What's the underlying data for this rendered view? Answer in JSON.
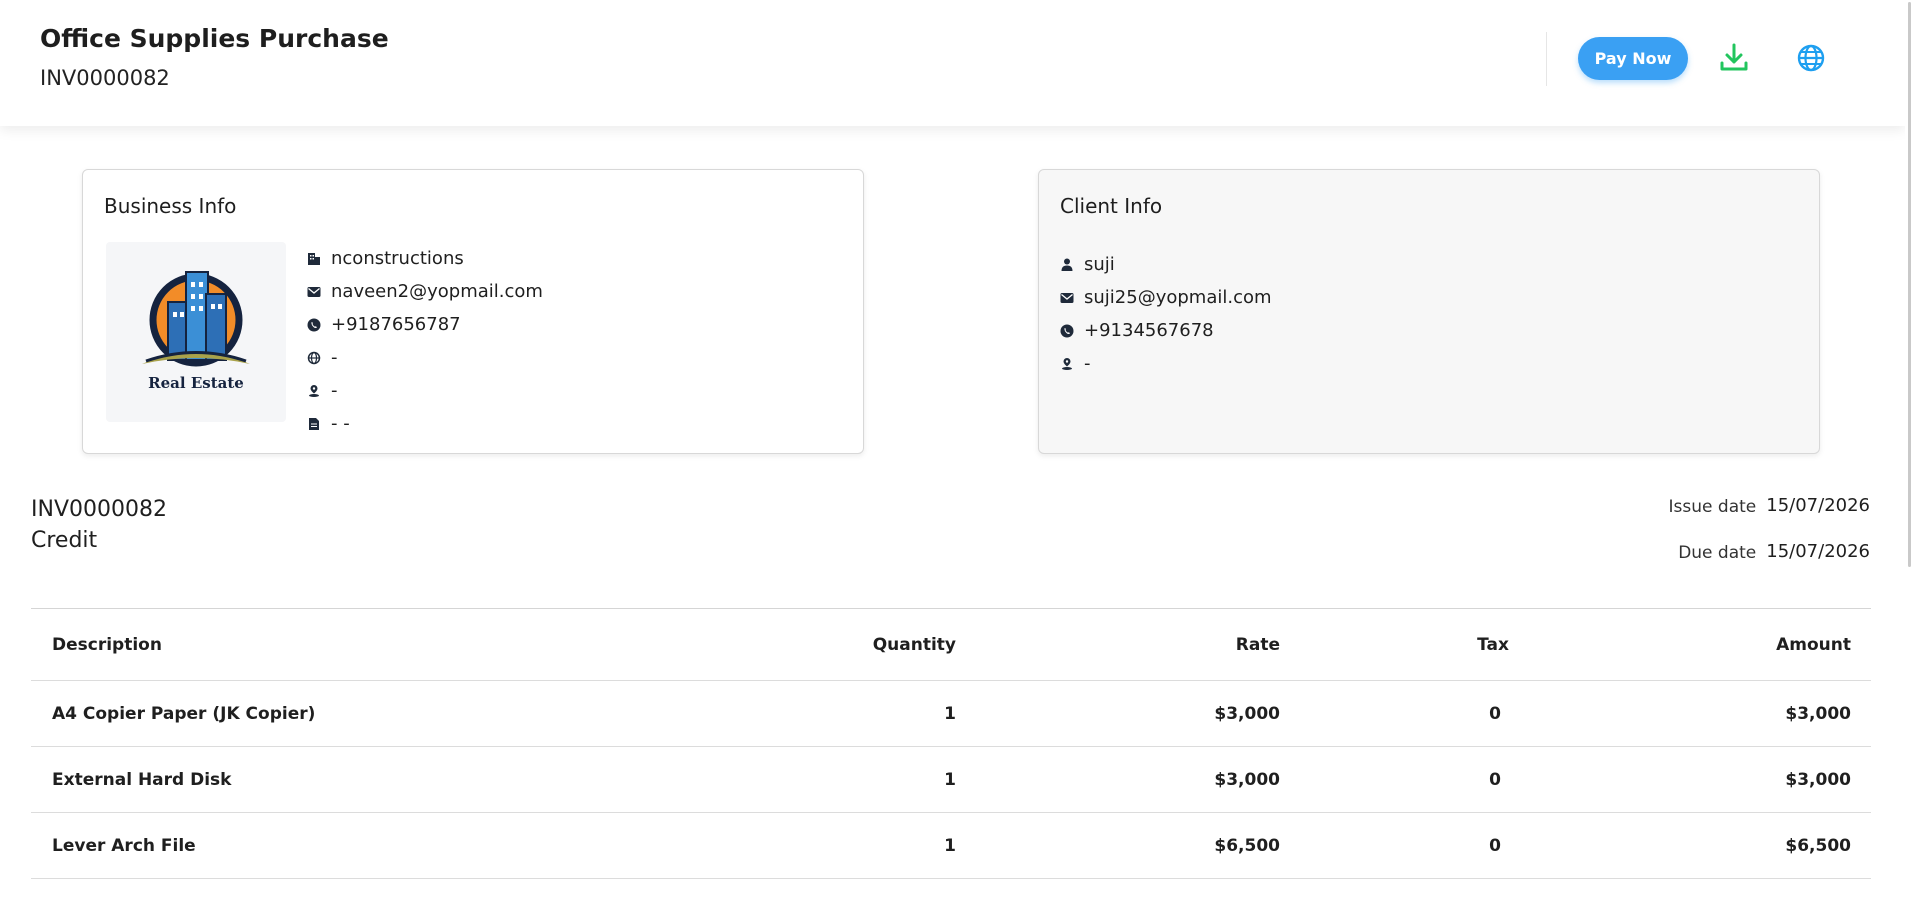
{
  "header": {
    "title": "Office Supplies Purchase",
    "invoice_number": "INV0000082",
    "pay_now_label": "Pay Now",
    "download_icon": "download-icon",
    "globe_icon": "globe-icon",
    "colors": {
      "pay_button": "#3aa0f3",
      "download": "#22c55e",
      "globe": "#1e9ff0"
    }
  },
  "business_info": {
    "title": "Business Info",
    "logo_text": "Real Estate",
    "name": "nconstructions",
    "email": "naveen2@yopmail.com",
    "phone": "+9187656787",
    "website": "-",
    "address": "-",
    "tax_id": "- -"
  },
  "client_info": {
    "title": "Client Info",
    "name": "suji",
    "email": "suji25@yopmail.com",
    "phone": "+9134567678",
    "address": "-"
  },
  "invoice": {
    "number": "INV0000082",
    "type": "Credit",
    "issue_date_label": "Issue date",
    "issue_date": "15/07/2026",
    "due_date_label": "Due date",
    "due_date": "15/07/2026"
  },
  "items_table": {
    "columns": [
      "Description",
      "Quantity",
      "Rate",
      "Tax",
      "Amount"
    ],
    "rows": [
      [
        "A4 Copier Paper (JK Copier)",
        "1",
        "$3,000",
        "0",
        "$3,000"
      ],
      [
        "External Hard Disk",
        "1",
        "$3,000",
        "0",
        "$3,000"
      ],
      [
        "Lever Arch File",
        "1",
        "$6,500",
        "0",
        "$6,500"
      ]
    ]
  }
}
